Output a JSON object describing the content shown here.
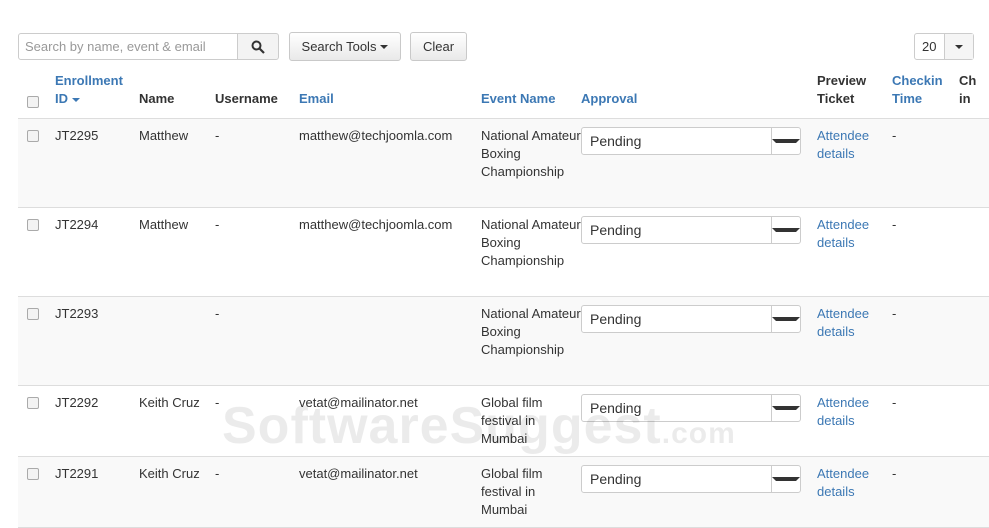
{
  "toolbar": {
    "search_placeholder": "Search by name, event & email",
    "search_tools_label": "Search Tools",
    "clear_label": "Clear",
    "limit_value": "20"
  },
  "table": {
    "headers": {
      "enrollment_id_line1": "Enrollment",
      "enrollment_id_line2": "ID",
      "name": "Name",
      "username": "Username",
      "email": "Email",
      "event_name": "Event Name",
      "approval": "Approval",
      "preview_ticket_line1": "Preview",
      "preview_ticket_line2": "Ticket",
      "checkin_time_line1": "Checkin",
      "checkin_time_line2": "Time",
      "checked_in_line1": "Ch",
      "checked_in_line2": "in"
    },
    "rows": [
      {
        "id": "JT2295",
        "name": "Matthew",
        "username": "-",
        "email": "matthew@techjoomla.com",
        "event": "National Amateur Boxing Championship",
        "approval": "Pending",
        "ticket": "Attendee details",
        "checkin": "-"
      },
      {
        "id": "JT2294",
        "name": "Matthew",
        "username": "-",
        "email": "matthew@techjoomla.com",
        "event": "National Amateur Boxing Championship",
        "approval": "Pending",
        "ticket": "Attendee details",
        "checkin": "-"
      },
      {
        "id": "JT2293",
        "name": "",
        "username": "-",
        "email": "",
        "event": "National Amateur Boxing Championship",
        "approval": "Pending",
        "ticket": "Attendee details",
        "checkin": "-"
      },
      {
        "id": "JT2292",
        "name": "Keith Cruz",
        "username": "-",
        "email": "vetat@mailinator.net",
        "event": "Global film festival in Mumbai",
        "approval": "Pending",
        "ticket": "Attendee details",
        "checkin": "-"
      },
      {
        "id": "JT2291",
        "name": "Keith Cruz",
        "username": "-",
        "email": "vetat@mailinator.net",
        "event": "Global film festival in Mumbai",
        "approval": "Pending",
        "ticket": "Attendee details",
        "checkin": "-"
      }
    ]
  },
  "watermark": {
    "main": "SoftwareSuggest",
    "suffix": ".com"
  },
  "colors": {
    "link": "#3c78b4",
    "row_alt": "#f9f9f9",
    "border": "#dddddd"
  }
}
